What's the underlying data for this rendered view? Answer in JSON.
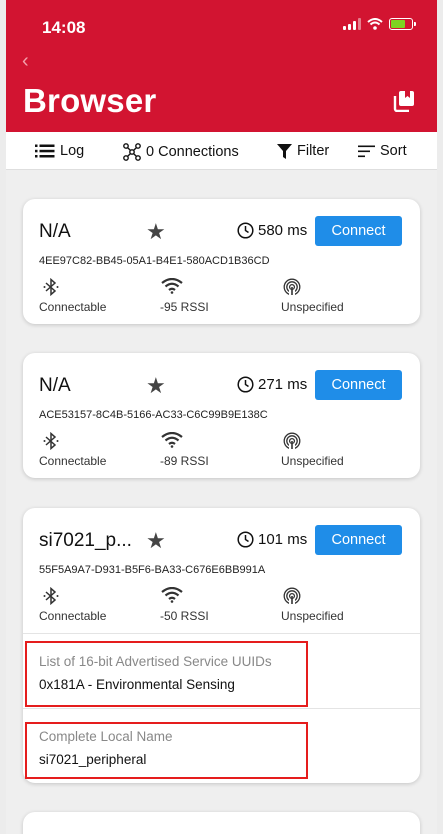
{
  "status_bar": {
    "time": "14:08"
  },
  "header": {
    "back_glyph": "‹",
    "title": "Browser",
    "action_icon": "bookmarks-icon"
  },
  "toolbar": {
    "log_label": "Log",
    "connections_label": "0 Connections",
    "filter_label": "Filter",
    "sort_label": "Sort"
  },
  "devices": [
    {
      "name": "N/A",
      "interval": "580 ms",
      "connect_label": "Connect",
      "uuid": "4EE97C82-BB45-05A1-B4E1-580ACD1B36CD",
      "connectable": "Connectable",
      "rssi": "-95 RSSI",
      "beacon_type": "Unspecified"
    },
    {
      "name": "N/A",
      "interval": "271 ms",
      "connect_label": "Connect",
      "uuid": "ACE53157-8C4B-5166-AC33-C6C99B9E138C",
      "connectable": "Connectable",
      "rssi": "-89 RSSI",
      "beacon_type": "Unspecified"
    },
    {
      "name": "si7021_p...",
      "interval": "101 ms",
      "connect_label": "Connect",
      "uuid": "55F5A9A7-D931-B5F6-BA33-C676E6BB991A",
      "connectable": "Connectable",
      "rssi": "-50 RSSI",
      "beacon_type": "Unspecified",
      "advertisement": [
        {
          "label": "List of 16-bit Advertised Service UUIDs",
          "value": "0x181A - Environmental Sensing"
        },
        {
          "label": "Complete Local Name",
          "value": "si7021_peripheral"
        }
      ]
    }
  ],
  "colors": {
    "header_bg": "#d21431",
    "connect_button": "#1f8de8",
    "highlight_border": "#e51d1d",
    "battery_fill": "#7ed321"
  }
}
